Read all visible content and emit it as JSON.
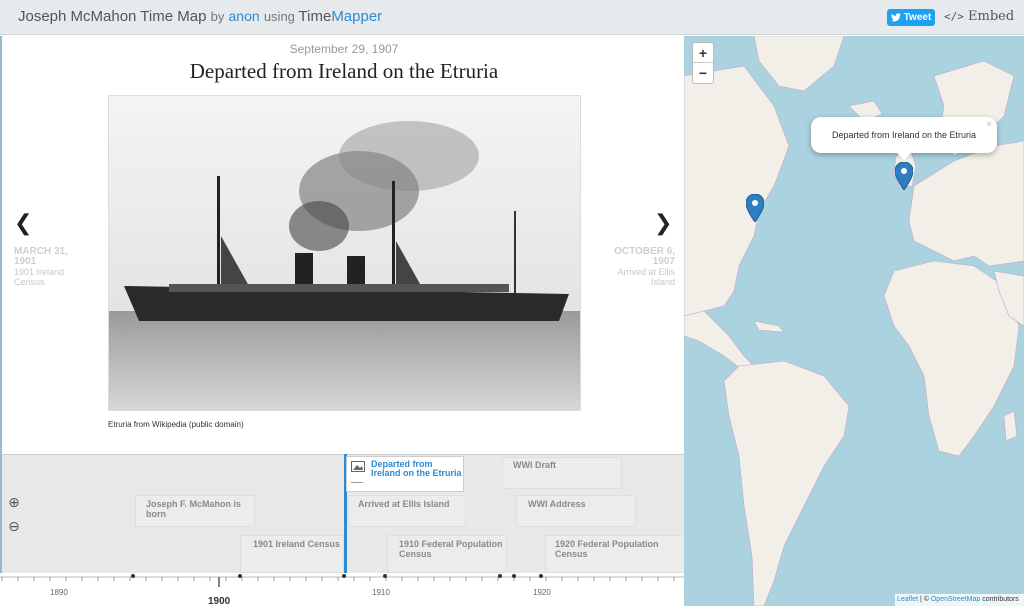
{
  "header": {
    "title": "Joseph McMahon Time Map",
    "by": "by",
    "author": "anon",
    "using": "using",
    "brand_part1": "Time",
    "brand_part2": "Mapper",
    "tweet_label": "Tweet",
    "embed_label": "Embed"
  },
  "slide": {
    "date": "September 29, 1907",
    "heading": "Departed from Ireland on the Etruria",
    "caption": "Etruria from Wikipedia (public domain)",
    "prev": {
      "date_line1": "MARCH 31,",
      "date_line2": "1901",
      "title_line1": "1901 Ireland",
      "title_line2": "Census"
    },
    "next": {
      "date_line1": "OCTOBER 6,",
      "date_line2": "1907",
      "title_line1": "Arrived at Ellis",
      "title_line2": "Island"
    }
  },
  "map": {
    "zoom_in": "+",
    "zoom_out": "−",
    "popup_text": "Departed from Ireland on the Etruria",
    "popup_close": "×",
    "attribution_leaflet": "Leaflet",
    "attribution_sep": " | © ",
    "attribution_osm": "OpenStreetMap",
    "attribution_suffix": " contributors",
    "marker_color": "#2d7fc1"
  },
  "timeline": {
    "current_line1": "Departed from",
    "current_line2": "Ireland on the Etruria",
    "events": {
      "born_l1": "Joseph F. McMahon is",
      "born_l2": "born",
      "census1901": "1901 Ireland Census",
      "ellis": "Arrived at Ellis Island",
      "census1910_l1": "1910 Federal Population",
      "census1910_l2": "Census",
      "wwi_draft": "WWI Draft",
      "wwi_address": "WWI Address",
      "census1920_l1": "1920 Federal Population",
      "census1920_l2": "Census"
    },
    "ticks": {
      "t1890": "1890",
      "t1900": "1900",
      "t1910": "1910",
      "t1920": "1920"
    },
    "accent_color": "#2d8bd1"
  }
}
